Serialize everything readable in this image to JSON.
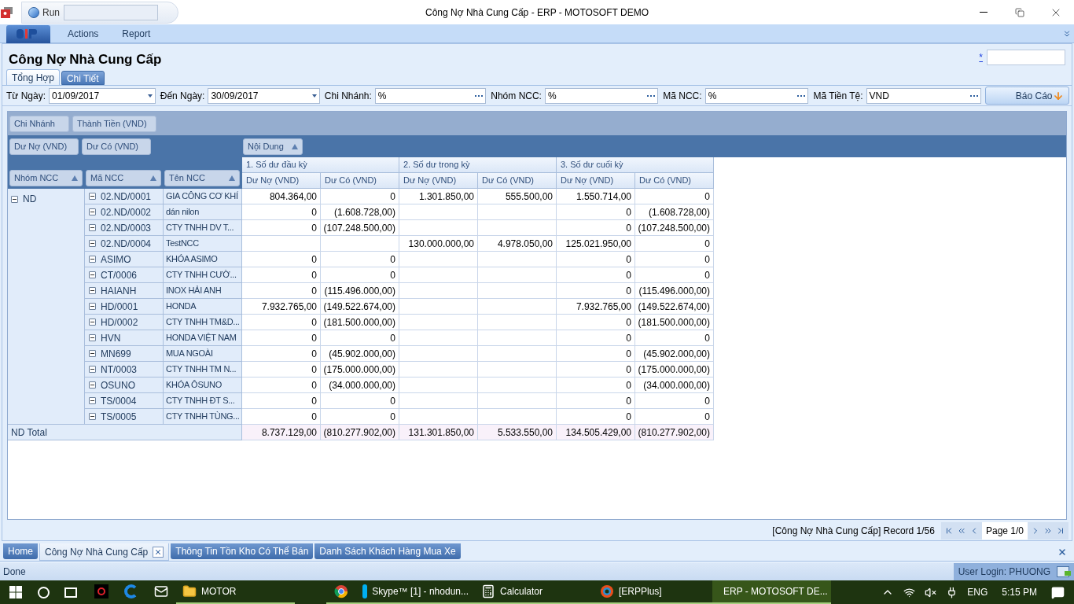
{
  "window": {
    "title": "Công Nợ Nhà Cung Cấp - ERP - MOTOSOFT DEMO",
    "quick_access": {
      "run_label": "Run"
    }
  },
  "menu": [
    "Actions",
    "Report"
  ],
  "page": {
    "title": "Công Nợ Nhà Cung Cấp",
    "link": "*"
  },
  "tabs": [
    {
      "label": "Tổng Hợp",
      "selected": true
    },
    {
      "label": "Chi Tiết",
      "selected": false
    }
  ],
  "filters": [
    {
      "label": "Từ Ngày:",
      "value": "01/09/2017",
      "kind": "date"
    },
    {
      "label": "Đến Ngày:",
      "value": "30/09/2017",
      "kind": "date"
    },
    {
      "label": "Chi Nhánh:",
      "value": "%",
      "kind": "lookup"
    },
    {
      "label": "Nhóm NCC:",
      "value": "%",
      "kind": "lookup"
    },
    {
      "label": "Mã NCC:",
      "value": "%",
      "kind": "lookup"
    },
    {
      "label": "Mã Tiền Tệ:",
      "value": "VND",
      "kind": "lookup"
    }
  ],
  "report_button": "Báo Cáo",
  "pivot": {
    "filter_fields": [
      "Chi Nhánh",
      "Thành Tiền (VND)"
    ],
    "data_fields": [
      "Dư Nợ (VND)",
      "Dư Có (VND)"
    ],
    "column_field": "Nội Dung",
    "row_fields": [
      "Nhóm NCC",
      "Mã NCC",
      "Tên NCC"
    ],
    "column_groups": [
      {
        "label": "1. Số dư đầu kỳ",
        "columns": [
          "Dư Nợ (VND)",
          "Dư Có (VND)"
        ]
      },
      {
        "label": "2. Số dư trong kỳ",
        "columns": [
          "Dư Nợ (VND)",
          "Dư Có (VND)"
        ]
      },
      {
        "label": "3. Số dư cuối kỳ",
        "columns": [
          "Dư Nợ (VND)",
          "Dư Có (VND)"
        ]
      }
    ],
    "group": {
      "label": "ND",
      "expanded": true,
      "rows": [
        {
          "code": "02.ND/0001",
          "name": "GIA CÔNG CƠ KHÍ",
          "expanded": true,
          "opening": {
            "debit": "804.364,00",
            "credit": "0"
          },
          "period": {
            "debit": "1.301.850,00",
            "credit": "555.500,00"
          },
          "closing": {
            "debit": "1.550.714,00",
            "credit": "0"
          }
        },
        {
          "code": "02.ND/0002",
          "name": "dán nilon",
          "expanded": true,
          "opening": {
            "debit": "0",
            "credit": "(1.608.728,00)"
          },
          "closing": {
            "debit": "0",
            "credit": "(1.608.728,00)"
          }
        },
        {
          "code": "02.ND/0003",
          "name": "CTY TNHH DV T...",
          "expanded": true,
          "opening": {
            "debit": "0",
            "credit": "(107.248.500,00)"
          },
          "closing": {
            "debit": "0",
            "credit": "(107.248.500,00)"
          }
        },
        {
          "code": "02.ND/0004",
          "name": "TestNCC",
          "expanded": true,
          "period": {
            "debit": "130.000.000,00",
            "credit": "4.978.050,00"
          },
          "closing": {
            "debit": "125.021.950,00",
            "credit": "0"
          }
        },
        {
          "code": "ASIMO",
          "name": "KHÓA ASIMO",
          "expanded": true,
          "opening": {
            "debit": "0",
            "credit": "0"
          },
          "closing": {
            "debit": "0",
            "credit": "0"
          }
        },
        {
          "code": "CT/0006",
          "name": "CTY TNHH CƯỜ...",
          "expanded": true,
          "opening": {
            "debit": "0",
            "credit": "0"
          },
          "closing": {
            "debit": "0",
            "credit": "0"
          }
        },
        {
          "code": "HAIANH",
          "name": "INOX HẢI ANH",
          "expanded": true,
          "opening": {
            "debit": "0",
            "credit": "(115.496.000,00)"
          },
          "closing": {
            "debit": "0",
            "credit": "(115.496.000,00)"
          }
        },
        {
          "code": "HD/0001",
          "name": "HONDA",
          "expanded": true,
          "opening": {
            "debit": "7.932.765,00",
            "credit": "(149.522.674,00)"
          },
          "closing": {
            "debit": "7.932.765,00",
            "credit": "(149.522.674,00)"
          }
        },
        {
          "code": "HD/0002",
          "name": "CTY TNHH TM&D...",
          "expanded": true,
          "opening": {
            "debit": "0",
            "credit": "(181.500.000,00)"
          },
          "closing": {
            "debit": "0",
            "credit": "(181.500.000,00)"
          }
        },
        {
          "code": "HVN",
          "name": "HONDA VIỆT NAM",
          "expanded": true,
          "opening": {
            "debit": "0",
            "credit": "0"
          },
          "closing": {
            "debit": "0",
            "credit": "0"
          }
        },
        {
          "code": "MN699",
          "name": "MUA NGOÀI",
          "expanded": true,
          "opening": {
            "debit": "0",
            "credit": "(45.902.000,00)"
          },
          "closing": {
            "debit": "0",
            "credit": "(45.902.000,00)"
          }
        },
        {
          "code": "NT/0003",
          "name": "CTY TNHH TM N...",
          "expanded": true,
          "opening": {
            "debit": "0",
            "credit": "(175.000.000,00)"
          },
          "closing": {
            "debit": "0",
            "credit": "(175.000.000,00)"
          }
        },
        {
          "code": "OSUNO",
          "name": "KHÓA ÔSUNO",
          "expanded": true,
          "opening": {
            "debit": "0",
            "credit": "(34.000.000,00)"
          },
          "closing": {
            "debit": "0",
            "credit": "(34.000.000,00)"
          }
        },
        {
          "code": "TS/0004",
          "name": "CTY TNHH ĐT S...",
          "expanded": true,
          "opening": {
            "debit": "0",
            "credit": "0"
          },
          "closing": {
            "debit": "0",
            "credit": "0"
          }
        },
        {
          "code": "TS/0005",
          "name": "CTY TNHH TÙNG...",
          "expanded": true,
          "opening": {
            "debit": "0",
            "credit": "0"
          },
          "closing": {
            "debit": "0",
            "credit": "0"
          }
        }
      ]
    },
    "total": {
      "label": "ND Total",
      "opening": {
        "debit": "8.737.129,00",
        "credit": "(810.277.902,00)"
      },
      "period": {
        "debit": "131.301.850,00",
        "credit": "5.533.550,00"
      },
      "closing": {
        "debit": "134.505.429,00",
        "credit": "(810.277.902,00)"
      }
    }
  },
  "record_info": "[Công Nợ Nhà Cung Cấp] Record 1/56",
  "pager": {
    "page": "Page 1/0"
  },
  "doc_tabs": [
    {
      "label": "Home",
      "selected": false
    },
    {
      "label": "Công Nợ Nhà Cung Cấp",
      "selected": true
    },
    {
      "label": "Thông Tin Tồn Kho Có Thể Bán",
      "selected": false
    },
    {
      "label": "Danh Sách Khách Hàng Mua Xe",
      "selected": false
    }
  ],
  "status": "Done",
  "user_login": "User Login: PHUONG",
  "taskbar": {
    "items": [
      {
        "kind": "garena",
        "running": false,
        "selected": false
      },
      {
        "kind": "edge",
        "running": false,
        "selected": false
      },
      {
        "kind": "mail",
        "running": false,
        "selected": false
      },
      {
        "kind": "folder",
        "label": "MOTOR",
        "running": true,
        "selected": false
      },
      {
        "kind": "chrome",
        "running": true,
        "selected": false
      },
      {
        "kind": "skype",
        "label": "Skype™ [1] - nhodun...",
        "running": true,
        "selected": false
      },
      {
        "kind": "calculator",
        "label": "Calculator",
        "running": true,
        "selected": false
      },
      {
        "kind": "erpplus",
        "label": "[ERPPlus]",
        "running": true,
        "selected": false
      },
      {
        "kind": "erp",
        "label": "ERP - MOTOSOFT DE...",
        "running": true,
        "selected": true
      }
    ],
    "language": "ENG",
    "time": "5:15 PM"
  }
}
